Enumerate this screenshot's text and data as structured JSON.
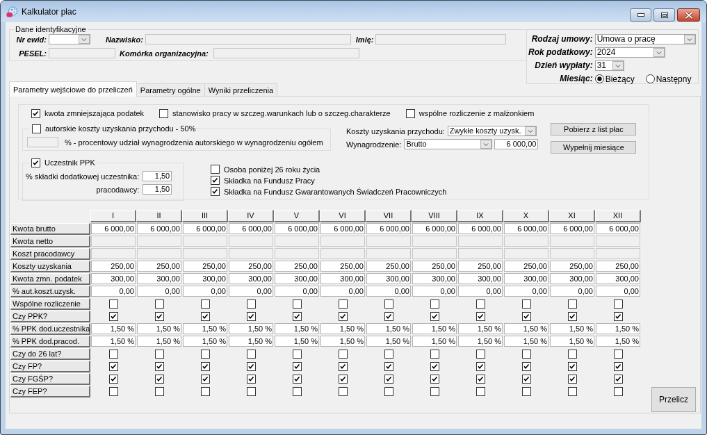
{
  "window": {
    "title": "Kalkulator płac"
  },
  "identification": {
    "title": "Dane identyfikacyjne",
    "rows": [
      [
        {
          "label": "Nr ewid:",
          "kind": "combo",
          "disabled": false
        },
        {
          "label": "Nazwisko:",
          "kind": "text",
          "disabled": true
        },
        {
          "label": "Imię:",
          "kind": "text",
          "disabled": true
        }
      ],
      [
        {
          "label": "PESEL:",
          "kind": "text",
          "disabled": true
        },
        {
          "label": "Komórka organizacyjna:",
          "kind": "text",
          "disabled": true
        }
      ]
    ]
  },
  "settings": {
    "fields": [
      {
        "label": "Rodzaj umowy:",
        "value": "Umowa o pracę"
      },
      {
        "label": "Rok podatkowy:",
        "value": "2024"
      },
      {
        "label": "Dzień wypłaty:",
        "value": "31"
      }
    ],
    "month": {
      "label": "Miesiąc:",
      "options": [
        {
          "label": "Bieżący",
          "selected": true
        },
        {
          "label": "Następny",
          "selected": false
        }
      ]
    }
  },
  "tabs": [
    {
      "label": "Parametry wejściowe do przeliczeń",
      "selected": true
    },
    {
      "label": "Parametry ogólne",
      "selected": false
    },
    {
      "label": "Wyniki przeliczenia",
      "selected": false
    }
  ],
  "parameters": {
    "options": [
      {
        "label": "kwota zmniejszająca podatek",
        "checked": true
      },
      {
        "label": "stanowisko pracy w szczeg.warunkach lub o szczeg.charakterze",
        "checked": false
      },
      {
        "label": "wspólne rozliczenie z małżonkiem",
        "checked": false
      }
    ],
    "author_costs": {
      "label": "autorskie koszty uzyskania przychodu - 50%",
      "checked": false,
      "share": {
        "label": "% - procentowy udział wynagrodzenia autorskiego w wynagrodzeniu ogółem",
        "disabled": true
      }
    },
    "costs": {
      "label": "Koszty uzyskania przychodu:",
      "value": "Zwykłe koszty uzysk."
    },
    "salary": {
      "label": "Wynagrodzenie:",
      "type": "Brutto",
      "amount": "6 000,00"
    },
    "buttons": [
      "Pobierz z list płac",
      "Wypełnij miesiące"
    ],
    "ppk": {
      "label": "Uczestnik PPK",
      "checked": true,
      "rates": [
        {
          "label": "% składki dodatkowej uczestnika:",
          "value": "1,50"
        },
        {
          "label": "pracodawcy:",
          "value": "1,50"
        }
      ]
    },
    "contributions": [
      {
        "label": "Osoba poniżej 26 roku życia",
        "checked": false
      },
      {
        "label": "Składka na Fundusz Pracy",
        "checked": true
      },
      {
        "label": "Składka na Fundusz Gwarantowanych Świadczeń Pracowniczych",
        "checked": true
      }
    ]
  },
  "table": {
    "columns": [
      "I",
      "II",
      "III",
      "IV",
      "V",
      "VI",
      "VII",
      "VIII",
      "IX",
      "X",
      "XI",
      "XII"
    ],
    "rows": [
      {
        "label": "Kwota brutto",
        "kind": "amount",
        "cells": [
          "6 000,00",
          "6 000,00",
          "6 000,00",
          "6 000,00",
          "6 000,00",
          "6 000,00",
          "6 000,00",
          "6 000,00",
          "6 000,00",
          "6 000,00",
          "6 000,00",
          "6 000,00"
        ]
      },
      {
        "label": "Kwota netto",
        "kind": "readonly"
      },
      {
        "label": "Koszt pracodawcy",
        "kind": "readonly"
      },
      {
        "label": "Koszty uzyskania",
        "kind": "amount",
        "cells": [
          "250,00",
          "250,00",
          "250,00",
          "250,00",
          "250,00",
          "250,00",
          "250,00",
          "250,00",
          "250,00",
          "250,00",
          "250,00",
          "250,00"
        ]
      },
      {
        "label": "Kwota zmn. podatek",
        "kind": "amount",
        "cells": [
          "300,00",
          "300,00",
          "300,00",
          "300,00",
          "300,00",
          "300,00",
          "300,00",
          "300,00",
          "300,00",
          "300,00",
          "300,00",
          "300,00"
        ]
      },
      {
        "label": "% aut.koszt.uzysk.",
        "kind": "amount",
        "cells": [
          "0,00",
          "0,00",
          "0,00",
          "0,00",
          "0,00",
          "0,00",
          "0,00",
          "0,00",
          "0,00",
          "0,00",
          "0,00",
          "0,00"
        ]
      },
      {
        "label": "Wspólne rozliczenie",
        "kind": "check",
        "cells": [
          {
            "checked": false
          },
          {
            "checked": false
          },
          {
            "checked": false
          },
          {
            "checked": false
          },
          {
            "checked": false
          },
          {
            "checked": false
          },
          {
            "checked": false
          },
          {
            "checked": false
          },
          {
            "checked": false
          },
          {
            "checked": false
          },
          {
            "checked": false
          },
          {
            "checked": false
          }
        ]
      },
      {
        "label": "Czy PPK?",
        "kind": "check",
        "cells": [
          {
            "checked": true
          },
          {
            "checked": true
          },
          {
            "checked": true
          },
          {
            "checked": true
          },
          {
            "checked": true
          },
          {
            "checked": true
          },
          {
            "checked": true
          },
          {
            "checked": true
          },
          {
            "checked": true
          },
          {
            "checked": true
          },
          {
            "checked": true
          },
          {
            "checked": true
          }
        ]
      },
      {
        "label": "% PPK dod.uczestnika",
        "kind": "amount",
        "cells": [
          "1,50 %",
          "1,50 %",
          "1,50 %",
          "1,50 %",
          "1,50 %",
          "1,50 %",
          "1,50 %",
          "1,50 %",
          "1,50 %",
          "1,50 %",
          "1,50 %",
          "1,50 %"
        ]
      },
      {
        "label": "% PPK dod.pracod.",
        "kind": "amount",
        "cells": [
          "1,50 %",
          "1,50 %",
          "1,50 %",
          "1,50 %",
          "1,50 %",
          "1,50 %",
          "1,50 %",
          "1,50 %",
          "1,50 %",
          "1,50 %",
          "1,50 %",
          "1,50 %"
        ]
      },
      {
        "label": "Czy do 26 lat?",
        "kind": "check",
        "cells": [
          {
            "checked": false
          },
          {
            "checked": false
          },
          {
            "checked": false
          },
          {
            "checked": false
          },
          {
            "checked": false
          },
          {
            "checked": false
          },
          {
            "checked": false
          },
          {
            "checked": false
          },
          {
            "checked": false
          },
          {
            "checked": false
          },
          {
            "checked": false
          },
          {
            "checked": false
          }
        ]
      },
      {
        "label": "Czy FP?",
        "kind": "check",
        "cells": [
          {
            "checked": true
          },
          {
            "checked": true
          },
          {
            "checked": true
          },
          {
            "checked": true
          },
          {
            "checked": true
          },
          {
            "checked": true
          },
          {
            "checked": true
          },
          {
            "checked": true
          },
          {
            "checked": true
          },
          {
            "checked": true
          },
          {
            "checked": true
          },
          {
            "checked": true
          }
        ]
      },
      {
        "label": "Czy FGŚP?",
        "kind": "check",
        "cells": [
          {
            "checked": true
          },
          {
            "checked": true
          },
          {
            "checked": true
          },
          {
            "checked": true
          },
          {
            "checked": true
          },
          {
            "checked": true
          },
          {
            "checked": true
          },
          {
            "checked": true
          },
          {
            "checked": true
          },
          {
            "checked": true
          },
          {
            "checked": true
          },
          {
            "checked": true
          }
        ]
      },
      {
        "label": "Czy FEP?",
        "kind": "check",
        "cells": [
          {
            "checked": false
          },
          {
            "checked": false
          },
          {
            "checked": false
          },
          {
            "checked": false
          },
          {
            "checked": false
          },
          {
            "checked": false
          },
          {
            "checked": false
          },
          {
            "checked": false
          },
          {
            "checked": false
          },
          {
            "checked": false
          },
          {
            "checked": false
          },
          {
            "checked": false
          }
        ]
      }
    ]
  },
  "calculate_button": "Przelicz"
}
